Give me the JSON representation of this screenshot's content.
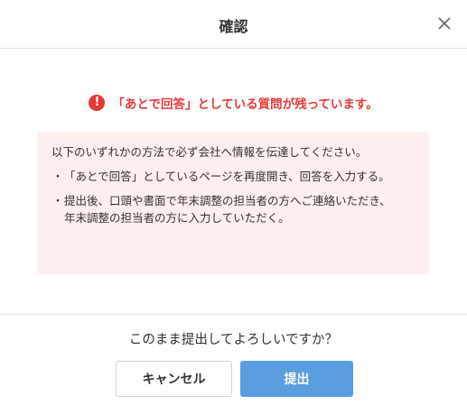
{
  "dialog": {
    "title": "確認",
    "close_icon": "close-icon"
  },
  "warning": {
    "icon": "exclamation-icon",
    "icon_glyph": "!",
    "text": "「あとで回答」としている質問が残っています。",
    "color": "#e53935"
  },
  "notice": {
    "intro": "以下のいずれかの方法で必ず会社へ情報を伝達してください。",
    "items": [
      {
        "bullet": "・",
        "text": "「あとで回答」としているページを再度開き、回答を入力する。"
      },
      {
        "bullet": "・",
        "text": "提出後、口頭や書面で年末調整の担当者の方へご連絡いただき、年末調整の担当者の方に入力していただく。"
      }
    ],
    "background": "#fcefed"
  },
  "footer": {
    "question": "このまま提出してよろしいですか？",
    "cancel_label": "キャンセル",
    "submit_label": "提出",
    "submit_color": "#5b9ee0"
  }
}
